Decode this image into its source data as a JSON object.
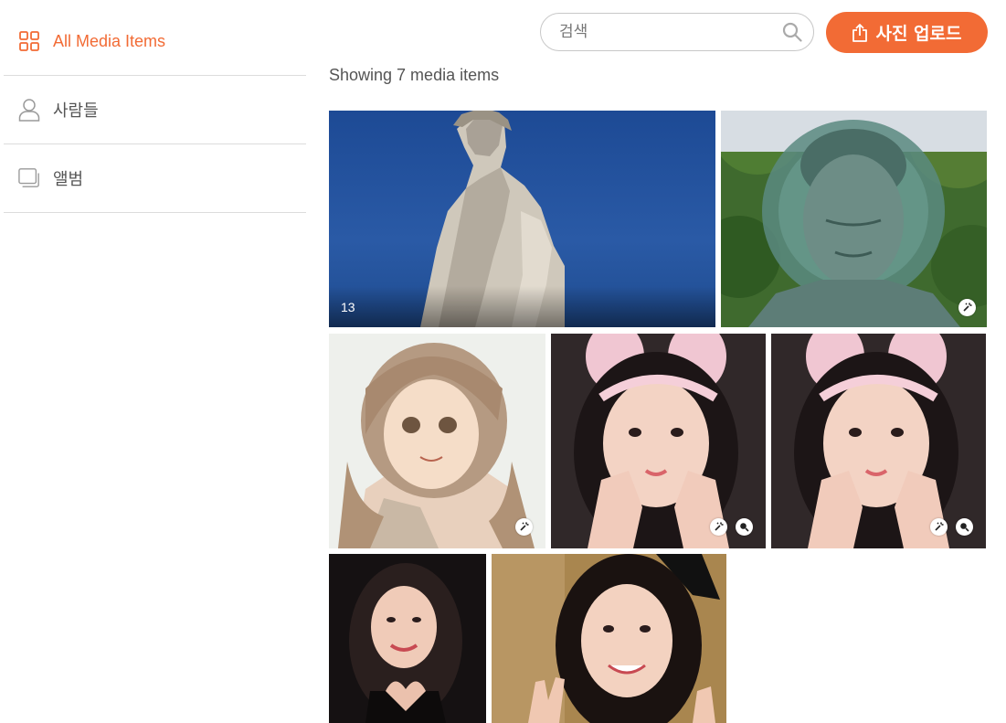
{
  "sidebar": {
    "items": [
      {
        "label": "All Media Items",
        "icon": "grid-icon",
        "active": true
      },
      {
        "label": "사람들",
        "icon": "person-icon",
        "active": false
      },
      {
        "label": "앨범",
        "icon": "album-icon",
        "active": false
      }
    ]
  },
  "search": {
    "placeholder": "검색",
    "value": ""
  },
  "upload": {
    "label": "사진 업로드"
  },
  "summary": {
    "text": "Showing 7 media items"
  },
  "colors": {
    "accent": "#f26b35"
  },
  "media": [
    {
      "subject": "statue",
      "count_label": "13",
      "badges": []
    },
    {
      "subject": "buddha",
      "count_label": "",
      "badges": [
        "magic-wand-icon"
      ]
    },
    {
      "subject": "anime-girl",
      "count_label": "",
      "badges": [
        "magic-wand-icon"
      ]
    },
    {
      "subject": "girl-bunny-ears",
      "count_label": "",
      "badges": [
        "magic-wand-icon",
        "face-search-icon"
      ]
    },
    {
      "subject": "girl-bunny-ears",
      "count_label": "",
      "badges": [
        "magic-wand-icon",
        "face-search-icon"
      ]
    },
    {
      "subject": "girl-heart-hands",
      "count_label": "",
      "badges": []
    },
    {
      "subject": "girl-peace-sign",
      "count_label": "",
      "badges": []
    }
  ]
}
